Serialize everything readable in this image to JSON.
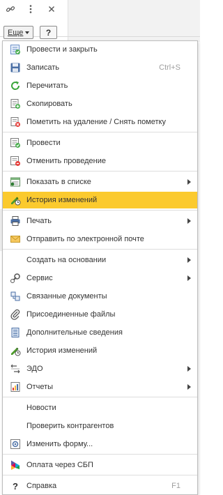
{
  "toolbar": {
    "more_label": "Еще",
    "help_label": "?"
  },
  "menu": {
    "items": [
      {
        "label": "Провести и закрыть",
        "icon": "post-and-close-icon"
      },
      {
        "label": "Записать",
        "shortcut": "Ctrl+S",
        "icon": "save-icon"
      },
      {
        "label": "Перечитать",
        "icon": "reread-icon"
      },
      {
        "label": "Скопировать",
        "icon": "copy-icon"
      },
      {
        "label": "Пометить на удаление / Снять пометку",
        "icon": "mark-delete-icon"
      },
      {
        "label": "Провести",
        "icon": "post-icon"
      },
      {
        "label": "Отменить проведение",
        "icon": "unpost-icon"
      },
      {
        "label": "Показать в списке",
        "icon": "show-in-list-icon"
      },
      {
        "label": "История изменений",
        "icon": "history-icon"
      },
      {
        "label": "Печать",
        "icon": "print-icon"
      },
      {
        "label": "Отправить по электронной почте",
        "icon": "email-icon"
      },
      {
        "label": "Создать на основании"
      },
      {
        "label": "Сервис",
        "icon": "service-icon"
      },
      {
        "label": "Связанные документы",
        "icon": "linked-docs-icon"
      },
      {
        "label": "Присоединенные файлы",
        "icon": "attachment-icon"
      },
      {
        "label": "Дополнительные сведения",
        "icon": "additional-info-icon"
      },
      {
        "label": "История изменений",
        "icon": "history-icon"
      },
      {
        "label": "ЭДО",
        "icon": "edo-icon"
      },
      {
        "label": "Отчеты",
        "icon": "reports-icon"
      },
      {
        "label": "Новости"
      },
      {
        "label": "Проверить контрагентов"
      },
      {
        "label": "Изменить форму...",
        "icon": "change-form-icon"
      },
      {
        "label": "Оплата через СБП",
        "icon": "sbp-icon"
      },
      {
        "label": "Справка",
        "shortcut": "F1",
        "icon": "help-icon"
      }
    ]
  },
  "colors": {
    "highlight": "#fbca2e",
    "shortcut": "#9e9e9e",
    "text": "#333333"
  }
}
